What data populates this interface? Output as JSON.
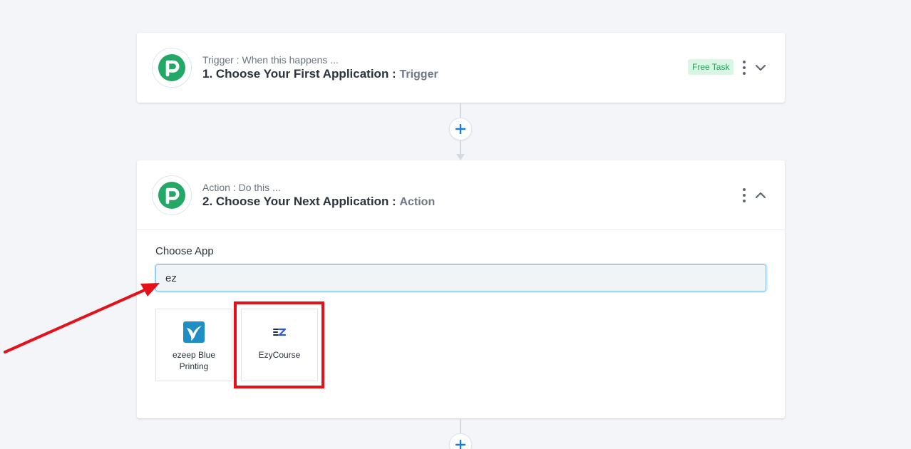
{
  "trigger": {
    "subtitle": "Trigger : When this happens ...",
    "title": "1. Choose Your First Application :",
    "title_suffix": "Trigger",
    "badge": "Free Task",
    "logo_icon": "pabbly-p-logo-icon",
    "menu_icon": "kebab-menu-icon",
    "toggle_icon": "chevron-down-icon"
  },
  "action": {
    "subtitle": "Action : Do this ...",
    "title": "2. Choose Your Next Application :",
    "title_suffix": "Action",
    "logo_icon": "pabbly-p-logo-icon",
    "menu_icon": "kebab-menu-icon",
    "toggle_icon": "chevron-up-icon",
    "choose_app_label": "Choose App",
    "search_value": "ez",
    "apps": [
      {
        "name": "ezeep Blue Printing",
        "icon": "ezeep-bird-icon"
      },
      {
        "name": "EzyCourse",
        "icon": "ezycourse-ez-icon"
      }
    ]
  },
  "colors": {
    "brand_green": "#22a563",
    "accent_blue": "#1a7fd4",
    "highlight_red": "#e5101a",
    "badge_bg": "#d9f5e4",
    "badge_text": "#24a05a"
  }
}
